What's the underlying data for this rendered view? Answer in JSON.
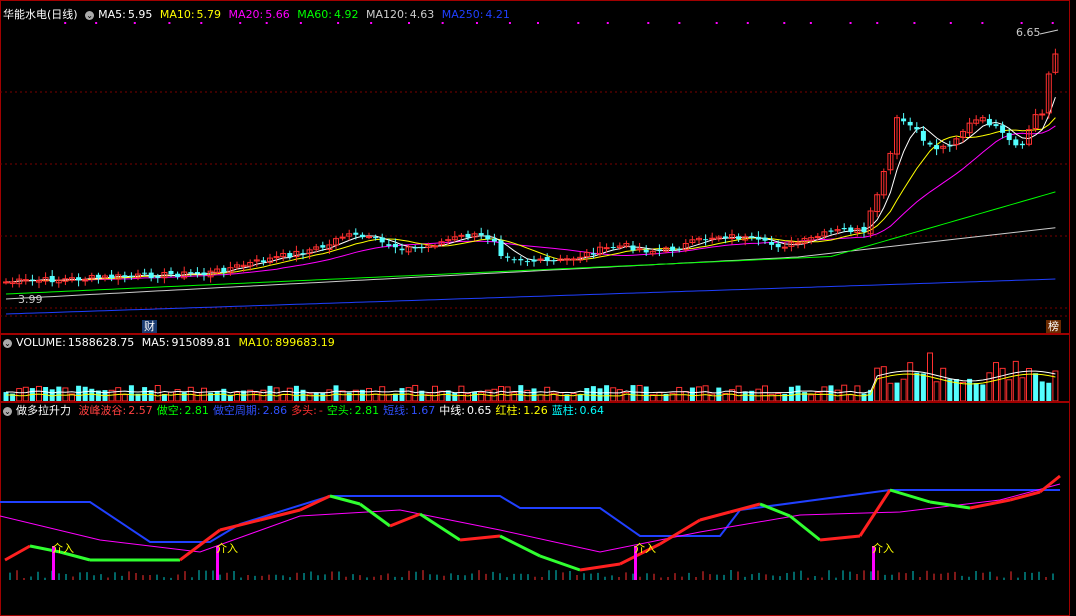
{
  "stock": {
    "name": "华能水电",
    "period": "(日线)"
  },
  "main": {
    "ma5": {
      "label": "MA5:",
      "value": "5.95",
      "color": "#ffffff"
    },
    "ma10": {
      "label": "MA10:",
      "value": "5.79",
      "color": "#ffff00"
    },
    "ma20": {
      "label": "MA20:",
      "value": "5.66",
      "color": "#ff00ff"
    },
    "ma60": {
      "label": "MA60:",
      "value": "4.92",
      "color": "#00ff00"
    },
    "ma120": {
      "label": "MA120:",
      "value": "4.63",
      "color": "#cccccc"
    },
    "ma250": {
      "label": "MA250:",
      "value": "4.21",
      "color": "#1f3fff"
    },
    "high_label": "6.65",
    "low_label": "3.99",
    "badge_cai": "财",
    "badge_bang": "榜"
  },
  "volume": {
    "label": "VOLUME:",
    "value": "1588628.75",
    "ma5_label": "MA5:",
    "ma5_value": "915089.81",
    "ma10_label": "MA10:",
    "ma10_value": "899683.19"
  },
  "indicator": {
    "name": "做多拉升力",
    "items": [
      {
        "label": "波峰波谷:",
        "value": "2.57",
        "color": "#ff4040"
      },
      {
        "label": "做空:",
        "value": "2.81",
        "color": "#00ff00"
      },
      {
        "label": "做空周期:",
        "value": "2.86",
        "color": "#3050ff"
      },
      {
        "label": "多头:",
        "value": "-",
        "color": "#ff3030"
      },
      {
        "label": "空头:",
        "value": "2.81",
        "color": "#00ff00"
      },
      {
        "label": "短线:",
        "value": "1.67",
        "color": "#3050ff"
      },
      {
        "label": "中线:",
        "value": "0.65",
        "color": "#ffffff"
      },
      {
        "label": "红柱:",
        "value": "1.26",
        "color": "#ffff00"
      },
      {
        "label": "蓝柱:",
        "value": "0.64",
        "color": "#00ffff"
      }
    ],
    "signal_label": "介入"
  }
}
